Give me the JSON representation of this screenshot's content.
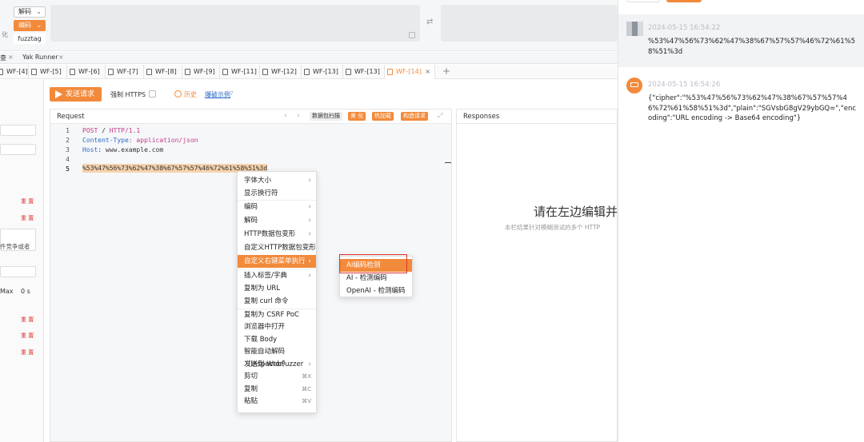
{
  "top": {
    "decode_select": "解码",
    "encode_select": "编码",
    "fuzztag": "fuzztag",
    "left_cut_label": "化"
  },
  "tabs_row1": {
    "left_fragment": "查",
    "yak_runner": "Yak Runner"
  },
  "tabs_row2": {
    "items": [
      "WF-[4]",
      "WF-[5]",
      "WF-[6]",
      "WF-[7]",
      "WF-[8]",
      "WF-[9]",
      "WF-[11]",
      "WF-[12]",
      "WF-[13]",
      "WF-[13]",
      "WF-[14]"
    ],
    "active_index": 10,
    "add": "+"
  },
  "toolbar": {
    "send_label": "发送请求",
    "force_https": "强制 HTTPS",
    "history": "历史",
    "example": "爆破示例"
  },
  "left": {
    "reset": "重 置",
    "race_text": "件竞争或者",
    "max_label": "Max",
    "max_value": "0 s"
  },
  "request": {
    "title": "Request",
    "btn_scan": "数据包扫描",
    "btn_beautify": "美 化",
    "btn_hotload": "热加载",
    "btn_construct": "构造请求",
    "lines": [
      "1",
      "2",
      "3",
      "4",
      "5"
    ],
    "code_line1_method": "POST",
    "code_line1_path": " / ",
    "code_line1_proto": "HTTP/1.1",
    "code_line2_key": "Content-Type",
    "code_line2_val": ": application/json",
    "code_line3_key": "Host",
    "code_line3_val": ": www.example.com",
    "code_line5": "%53%47%56%73%62%47%38%67%57%57%46%72%61%58%51%3d"
  },
  "responses": {
    "title": "Responses",
    "hint_big": "请在左边编辑并",
    "hint_small": "本栏结果针对模糊测试的多个 HTTP"
  },
  "context_menu": {
    "items": [
      {
        "label": "字体大小",
        "arrow": true
      },
      {
        "label": "显示换行符"
      },
      {
        "label": "编码",
        "arrow": true
      },
      {
        "label": "解码",
        "arrow": true
      },
      {
        "label": "HTTP数据包变形",
        "arrow": true
      },
      {
        "label": "自定义HTTP数据包变形",
        "arrow": true
      },
      {
        "label": "自定义右键菜单执行",
        "arrow": true
      },
      {
        "label": "插入标签/字典",
        "arrow": true
      },
      {
        "label": "复制为 URL"
      },
      {
        "label": "复制 curl 命令"
      },
      {
        "label": "复制为 CSRF PoC"
      },
      {
        "label": "浏览器中打开"
      },
      {
        "label": "下载 Body"
      },
      {
        "label": "智能自动解码（Inspector）"
      },
      {
        "label": "发送到 WebFuzzer",
        "arrow": true
      },
      {
        "label": "剪切",
        "shortcut": "⌘X"
      },
      {
        "label": "复制",
        "shortcut": "⌘C"
      },
      {
        "label": "粘贴",
        "shortcut": "⌘V"
      }
    ],
    "highlighted_index": 6
  },
  "submenu": {
    "items": [
      "AI编码检测",
      "AI - 检测编码",
      "OpenAI - 检测编码"
    ],
    "highlighted_index": 0
  },
  "chat": {
    "messages": [
      {
        "time": "2024-05-15 16:54:22",
        "text": "%53%47%56%73%62%47%38%67%57%57%46%72%61%58%51%3d"
      },
      {
        "time": "2024-05-15 16:54:26",
        "text": "{\"cipher\":\"%53%47%56%73%62%47%38%67%57%57%46%72%61%58%51%3d\",\"plain\":\"SGVsbG8gV29ybGQ=\",\"encoding\":\"URL encoding -> Base64 encoding\"}"
      }
    ]
  },
  "colors": {
    "accent": "#f28a3b",
    "highlight_box": "#e0342f",
    "link": "#2b6cc4"
  }
}
